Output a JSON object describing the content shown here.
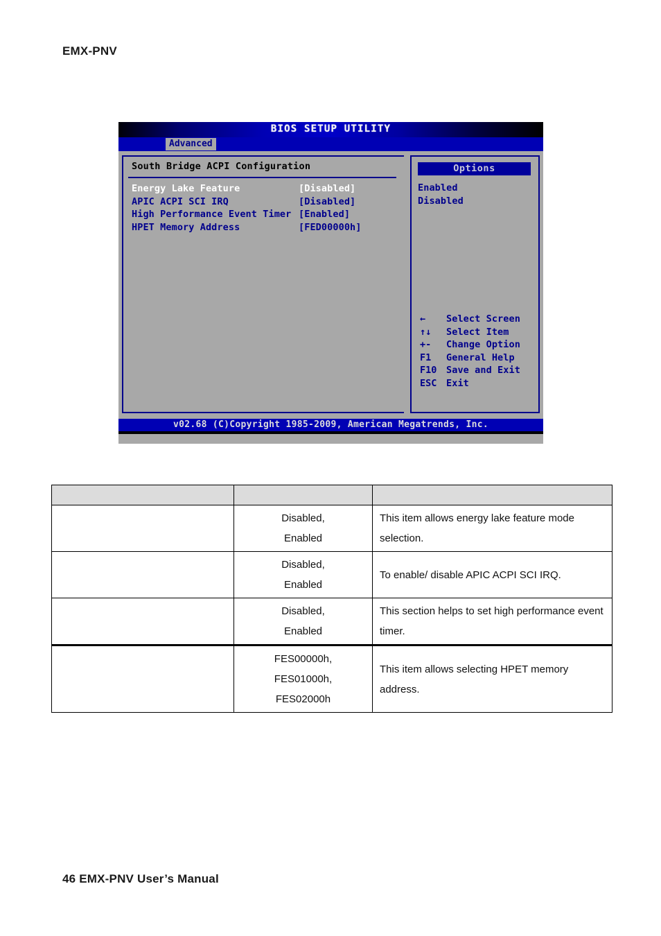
{
  "page": {
    "header": "EMX-PNV",
    "footer": "46 EMX-PNV User’s Manual"
  },
  "bios": {
    "title": "BIOS SETUP UTILITY",
    "active_tab": "Advanced",
    "section_title": "South Bridge ACPI Configuration",
    "settings": [
      {
        "label": "Energy Lake Feature",
        "value": "[Disabled]",
        "selected": true
      },
      {
        "label": "APIC ACPI SCI IRQ",
        "value": "[Disabled]",
        "selected": false
      },
      {
        "label": "High Performance Event Timer",
        "value": "[Enabled]",
        "selected": false
      },
      {
        "label": "HPET Memory Address",
        "value": "[FED00000h]",
        "selected": false
      }
    ],
    "options_panel": {
      "header": "Options",
      "items": [
        "Enabled",
        "Disabled"
      ]
    },
    "nav_help": [
      {
        "key": "←",
        "desc": "Select Screen"
      },
      {
        "key": "↑↓",
        "desc": "Select Item"
      },
      {
        "key": "+-",
        "desc": "Change Option"
      },
      {
        "key": "F1",
        "desc": "General Help"
      },
      {
        "key": "F10",
        "desc": "Save and Exit"
      },
      {
        "key": "ESC",
        "desc": "Exit"
      }
    ],
    "footer": "v02.68 (C)Copyright 1985-2009, American Megatrends, Inc.",
    "colors": {
      "screen_bg": "#a8a8a8",
      "accent_blue": "#0000b4",
      "text_blue": "#00008c",
      "selected_text": "#ffffff"
    }
  },
  "table": {
    "header": {
      "name": "",
      "options": "",
      "description": ""
    },
    "rows": [
      {
        "name": "",
        "options": "Disabled,\nEnabled",
        "description": "This item allows energy lake feature mode selection."
      },
      {
        "name": "",
        "options": "Disabled,\nEnabled",
        "description": "To enable/ disable APIC ACPI SCI IRQ."
      },
      {
        "name": "",
        "options": "Disabled,\nEnabled",
        "description": "This section helps to set high performance event timer."
      },
      {
        "name": "",
        "options": "FES00000h,\nFES01000h,\nFES02000h",
        "description": "This item allows selecting HPET memory address."
      }
    ]
  }
}
